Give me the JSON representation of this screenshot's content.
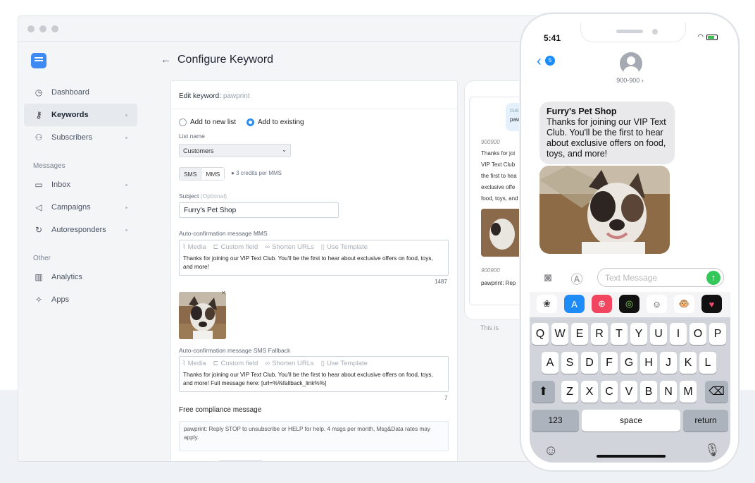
{
  "app": {
    "page_title": "Configure Keyword",
    "sidebar": {
      "items": [
        {
          "label": "Dashboard",
          "icon": "dashboard-icon"
        },
        {
          "label": "Keywords",
          "icon": "key-icon"
        },
        {
          "label": "Subscribers",
          "icon": "subscribers-icon"
        }
      ],
      "section_messages": "Messages",
      "messages_items": [
        {
          "label": "Inbox",
          "icon": "inbox-icon"
        },
        {
          "label": "Campaigns",
          "icon": "megaphone-icon"
        },
        {
          "label": "Autoresponders",
          "icon": "autoresponder-icon"
        }
      ],
      "section_other": "Other",
      "other_items": [
        {
          "label": "Analytics",
          "icon": "analytics-icon"
        },
        {
          "label": "Apps",
          "icon": "apps-icon"
        }
      ]
    },
    "form": {
      "edit_keyword_label": "Edit keyword:",
      "keyword": "pawprint",
      "radio_new": "Add to new list",
      "radio_existing": "Add to existing",
      "list_name_label": "List name",
      "list_name_value": "Customers",
      "seg_sms": "SMS",
      "seg_mms": "MMS",
      "credits": "3 credits per MMS",
      "subject_label": "Subject",
      "subject_optional": "(Optional)",
      "subject_value": "Furry's Pet Shop",
      "mms_label": "Auto-confirmation message MMS",
      "toolbar": {
        "media": "Media",
        "custom_field": "Custom field",
        "shorten": "Shorten URLs",
        "template": "Use Template"
      },
      "mms_text": "Thanks for joining our VIP Text Club. You'll be the first to hear about exclusive offers on food, toys, and more!",
      "mms_count": "1487",
      "sms_label": "Auto-confirmation message SMS Fallback",
      "sms_text": "Thanks for joining our VIP Text Club. You'll be the first to hear about exclusive offers on food, toys, and more! Full message here: [url=%%fallback_link%%]",
      "sms_count": "7",
      "compliance_title": "Free compliance message",
      "compliance_text": "pawprint: Reply STOP to unsubscribe or HELP for help. 4 msgs per month, Msg&Data rates may apply."
    },
    "preview": {
      "bubble_prefix": "cus",
      "bubble_text": "paw",
      "sender1": "900900",
      "lines1": [
        "Thanks for joi",
        "VIP Text Club",
        "the first to hea",
        "exclusive offe",
        "food, toys, and"
      ],
      "sender2": "900900",
      "line2": "pawprint: Rep",
      "caption": "This is"
    }
  },
  "phone": {
    "time": "5:41",
    "badge": "5",
    "contact": "900-900 ›",
    "message_title": "Furry's Pet Shop",
    "message_body": "Thanks for joining our VIP Text Club. You'll be the first to hear about exclusive offers on food, toys, and more!",
    "compose_placeholder": "Text Message",
    "keys_row1": [
      "Q",
      "W",
      "E",
      "R",
      "T",
      "Y",
      "U",
      "I",
      "O",
      "P"
    ],
    "keys_row2": [
      "A",
      "S",
      "D",
      "F",
      "G",
      "H",
      "J",
      "K",
      "L"
    ],
    "keys_row3": [
      "Z",
      "X",
      "C",
      "V",
      "B",
      "N",
      "M"
    ],
    "key_123": "123",
    "key_space": "space",
    "key_return": "return"
  },
  "colors": {
    "accent": "#2d8cf0",
    "imessage_blue": "#1a8cff",
    "send_green": "#34c759"
  }
}
